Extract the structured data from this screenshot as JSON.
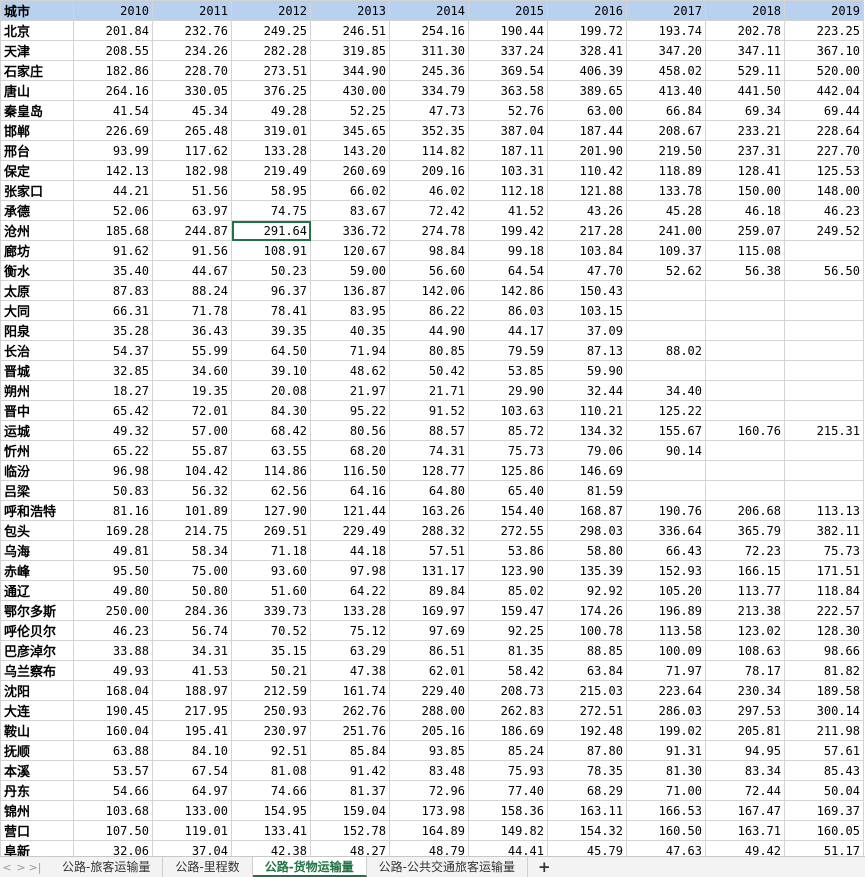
{
  "table": {
    "header": [
      "城市",
      "2010",
      "2011",
      "2012",
      "2013",
      "2014",
      "2015",
      "2016",
      "2017",
      "2018",
      "2019"
    ],
    "rows": [
      [
        "北京",
        "201.84",
        "232.76",
        "249.25",
        "246.51",
        "254.16",
        "190.44",
        "199.72",
        "193.74",
        "202.78",
        "223.25"
      ],
      [
        "天津",
        "208.55",
        "234.26",
        "282.28",
        "319.85",
        "311.30",
        "337.24",
        "328.41",
        "347.20",
        "347.11",
        "367.10"
      ],
      [
        "石家庄",
        "182.86",
        "228.70",
        "273.51",
        "344.90",
        "245.36",
        "369.54",
        "406.39",
        "458.02",
        "529.11",
        "520.00"
      ],
      [
        "唐山",
        "264.16",
        "330.05",
        "376.25",
        "430.00",
        "334.79",
        "363.58",
        "389.65",
        "413.40",
        "441.50",
        "442.04"
      ],
      [
        "秦皇岛",
        "41.54",
        "45.34",
        "49.28",
        "52.25",
        "47.73",
        "52.76",
        "63.00",
        "66.84",
        "69.34",
        "69.44"
      ],
      [
        "邯郸",
        "226.69",
        "265.48",
        "319.01",
        "345.65",
        "352.35",
        "387.04",
        "187.44",
        "208.67",
        "233.21",
        "228.64"
      ],
      [
        "邢台",
        "93.99",
        "117.62",
        "133.28",
        "143.20",
        "114.82",
        "187.11",
        "201.90",
        "219.50",
        "237.31",
        "227.70"
      ],
      [
        "保定",
        "142.13",
        "182.98",
        "219.49",
        "260.69",
        "209.16",
        "103.31",
        "110.42",
        "118.89",
        "128.41",
        "125.53"
      ],
      [
        "张家口",
        "44.21",
        "51.56",
        "58.95",
        "66.02",
        "46.02",
        "112.18",
        "121.88",
        "133.78",
        "150.00",
        "148.00"
      ],
      [
        "承德",
        "52.06",
        "63.97",
        "74.75",
        "83.67",
        "72.42",
        "41.52",
        "43.26",
        "45.28",
        "46.18",
        "46.23"
      ],
      [
        "沧州",
        "185.68",
        "244.87",
        "291.64",
        "336.72",
        "274.78",
        "199.42",
        "217.28",
        "241.00",
        "259.07",
        "249.52"
      ],
      [
        "廊坊",
        "91.62",
        "91.56",
        "108.91",
        "120.67",
        "98.84",
        "99.18",
        "103.84",
        "109.37",
        "115.08",
        ""
      ],
      [
        "衡水",
        "35.40",
        "44.67",
        "50.23",
        "59.00",
        "56.60",
        "64.54",
        "47.70",
        "52.62",
        "56.38",
        "56.50"
      ],
      [
        "太原",
        "87.83",
        "88.24",
        "96.37",
        "136.87",
        "142.06",
        "142.86",
        "150.43",
        "",
        "",
        ""
      ],
      [
        "大同",
        "66.31",
        "71.78",
        "78.41",
        "83.95",
        "86.22",
        "86.03",
        "103.15",
        "",
        "",
        ""
      ],
      [
        "阳泉",
        "35.28",
        "36.43",
        "39.35",
        "40.35",
        "44.90",
        "44.17",
        "37.09",
        "",
        "",
        ""
      ],
      [
        "长治",
        "54.37",
        "55.99",
        "64.50",
        "71.94",
        "80.85",
        "79.59",
        "87.13",
        "88.02",
        "",
        ""
      ],
      [
        "晋城",
        "32.85",
        "34.60",
        "39.10",
        "48.62",
        "50.42",
        "53.85",
        "59.90",
        "",
        "",
        ""
      ],
      [
        "朔州",
        "18.27",
        "19.35",
        "20.08",
        "21.97",
        "21.71",
        "29.90",
        "32.44",
        "34.40",
        "",
        ""
      ],
      [
        "晋中",
        "65.42",
        "72.01",
        "84.30",
        "95.22",
        "91.52",
        "103.63",
        "110.21",
        "125.22",
        "",
        ""
      ],
      [
        "运城",
        "49.32",
        "57.00",
        "68.42",
        "80.56",
        "88.57",
        "85.72",
        "134.32",
        "155.67",
        "160.76",
        "215.31"
      ],
      [
        "忻州",
        "65.22",
        "55.87",
        "63.55",
        "68.20",
        "74.31",
        "75.73",
        "79.06",
        "90.14",
        "",
        ""
      ],
      [
        "临汾",
        "96.98",
        "104.42",
        "114.86",
        "116.50",
        "128.77",
        "125.86",
        "146.69",
        "",
        "",
        ""
      ],
      [
        "吕梁",
        "50.83",
        "56.32",
        "62.56",
        "64.16",
        "64.80",
        "65.40",
        "81.59",
        "",
        "",
        ""
      ],
      [
        "呼和浩特",
        "81.16",
        "101.89",
        "127.90",
        "121.44",
        "163.26",
        "154.40",
        "168.87",
        "190.76",
        "206.68",
        "113.13"
      ],
      [
        "包头",
        "169.28",
        "214.75",
        "269.51",
        "229.49",
        "288.32",
        "272.55",
        "298.03",
        "336.64",
        "365.79",
        "382.11"
      ],
      [
        "乌海",
        "49.81",
        "58.34",
        "71.18",
        "44.18",
        "57.51",
        "53.86",
        "58.80",
        "66.43",
        "72.23",
        "75.73"
      ],
      [
        "赤峰",
        "95.50",
        "75.00",
        "93.60",
        "97.98",
        "131.17",
        "123.90",
        "135.39",
        "152.93",
        "166.15",
        "171.51"
      ],
      [
        "通辽",
        "49.80",
        "50.80",
        "51.60",
        "64.22",
        "89.84",
        "85.02",
        "92.92",
        "105.20",
        "113.77",
        "118.84"
      ],
      [
        "鄂尔多斯",
        "250.00",
        "284.36",
        "339.73",
        "133.28",
        "169.97",
        "159.47",
        "174.26",
        "196.89",
        "213.38",
        "222.57"
      ],
      [
        "呼伦贝尔",
        "46.23",
        "56.74",
        "70.52",
        "75.12",
        "97.69",
        "92.25",
        "100.78",
        "113.58",
        "123.02",
        "128.30"
      ],
      [
        "巴彦淖尔",
        "33.88",
        "34.31",
        "35.15",
        "63.29",
        "86.51",
        "81.35",
        "88.85",
        "100.09",
        "108.63",
        "98.66"
      ],
      [
        "乌兰察布",
        "49.93",
        "41.53",
        "50.21",
        "47.38",
        "62.01",
        "58.42",
        "63.84",
        "71.97",
        "78.17",
        "81.82"
      ],
      [
        "沈阳",
        "168.04",
        "188.97",
        "212.59",
        "161.74",
        "229.40",
        "208.73",
        "215.03",
        "223.64",
        "230.34",
        "189.58"
      ],
      [
        "大连",
        "190.45",
        "217.95",
        "250.93",
        "262.76",
        "288.00",
        "262.83",
        "272.51",
        "286.03",
        "297.53",
        "300.14"
      ],
      [
        "鞍山",
        "160.04",
        "195.41",
        "230.97",
        "251.76",
        "205.16",
        "186.69",
        "192.48",
        "199.02",
        "205.81",
        "211.98"
      ],
      [
        "抚顺",
        "63.88",
        "84.10",
        "92.51",
        "85.84",
        "93.85",
        "85.24",
        "87.80",
        "91.31",
        "94.95",
        "57.61"
      ],
      [
        "本溪",
        "53.57",
        "67.54",
        "81.08",
        "91.42",
        "83.48",
        "75.93",
        "78.35",
        "81.30",
        "83.34",
        "85.43"
      ],
      [
        "丹东",
        "54.66",
        "64.97",
        "74.66",
        "81.37",
        "72.96",
        "77.40",
        "68.29",
        "71.00",
        "72.44",
        "50.04"
      ],
      [
        "锦州",
        "103.68",
        "133.00",
        "154.95",
        "159.04",
        "173.98",
        "158.36",
        "163.11",
        "166.53",
        "167.47",
        "169.37"
      ],
      [
        "营口",
        "107.50",
        "119.01",
        "133.41",
        "152.78",
        "164.89",
        "149.82",
        "154.32",
        "160.50",
        "163.71",
        "160.05"
      ],
      [
        "阜新",
        "32.06",
        "37.04",
        "42.38",
        "48.27",
        "48.79",
        "44.41",
        "45.79",
        "47.63",
        "49.42",
        "51.17"
      ]
    ]
  },
  "tabs": {
    "nav_prev": "<",
    "nav_next": ">",
    "nav_last": ">|",
    "items": [
      "公路-旅客运输量",
      "公路-里程数",
      "公路-货物运输量",
      "公路-公共交通旅客运输量"
    ],
    "active_index": 2,
    "add_label": "+"
  }
}
